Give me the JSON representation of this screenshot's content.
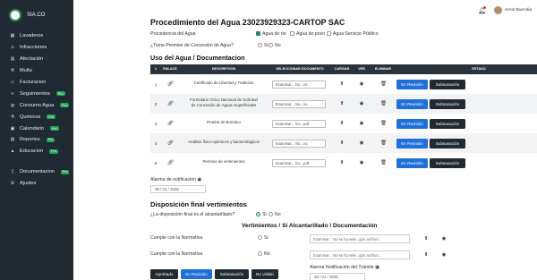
{
  "sidebar": {
    "brand": "SIA.CO",
    "items": [
      {
        "label": "Lavaderos",
        "icon": "grid-icon",
        "badge": ""
      },
      {
        "label": "Infracciones",
        "icon": "warning-icon",
        "badge": ""
      },
      {
        "label": "Afectación",
        "icon": "chart-icon",
        "badge": ""
      },
      {
        "label": "Multa",
        "icon": "gavel-icon",
        "badge": ""
      },
      {
        "label": "Facturacion",
        "icon": "invoice-icon",
        "badge": ""
      },
      {
        "label": "Seguimientos",
        "icon": "list-icon",
        "badge": "Pro"
      },
      {
        "label": "Consumo Agua",
        "icon": "water-icon",
        "badge": "Pro"
      },
      {
        "label": "Quimicos",
        "icon": "flask-icon",
        "badge": "Pro"
      },
      {
        "label": "Calendario",
        "icon": "calendar-icon",
        "badge": "Pro"
      },
      {
        "label": "Reportes",
        "icon": "report-icon",
        "badge": "Pro"
      },
      {
        "label": "Educacion",
        "icon": "education-icon",
        "badge": "Pro"
      }
    ],
    "bottom_items": [
      {
        "label": "Documentacion",
        "icon": "document-icon",
        "badge": "Pro"
      },
      {
        "label": "Ajustes",
        "icon": "gear-icon",
        "badge": ""
      }
    ]
  },
  "topbar": {
    "user": "Arnol Buendia"
  },
  "page": {
    "title": "Procedimiento del Agua 23023929323-CARTOP SAC",
    "source_label": "Procedencia del Agua",
    "source_options": [
      {
        "label": "Agua de rio",
        "checked": true
      },
      {
        "label": "Agua de pozo",
        "checked": false
      },
      {
        "label": "Agua Servicio Público",
        "checked": false
      }
    ],
    "permit_question": "¿Tiene Permiso de Concesión de Agua?",
    "yes": "Si",
    "no": "No",
    "uses_title": "Uso del Agua / Documentacion"
  },
  "table": {
    "headers": [
      "#",
      "ENLACE",
      "DESCRIPCION",
      "SELECCIONAR DOCUMENTO",
      "CARGAR",
      "VER",
      "ELIMINAR",
      "ESTADO"
    ],
    "rows": [
      {
        "num": "1",
        "desc1": "Certificado de Libertad y Tradición",
        "desc2": "",
        "file": "Examinar...  No...vo."
      },
      {
        "num": "2",
        "desc1": "Formulario Único Nacional de Solicitud",
        "desc2": "de Concesión de Aguas Superficiales",
        "file": "Examinar...  No...vo."
      },
      {
        "num": "3",
        "desc1": "Prueba de Bombeo",
        "desc2": "",
        "file": "Examinar...  foc...pdf"
      },
      {
        "num": "4",
        "desc1": "Análisis físico-químicos y bacteriológicos",
        "desc2": "",
        "file": "Examinar...  No...vo."
      },
      {
        "num": "5",
        "desc1": "Permiso de vertimientos",
        "desc2": "",
        "file": "Examinar...  foc...pdf"
      }
    ],
    "status_button": "En Revisión",
    "fix_button": "Subsanación"
  },
  "notification": {
    "label": "Alarma de notificación",
    "date": "30 / 01 / 2025"
  },
  "discharge": {
    "title": "Disposición final vertimientos",
    "question": "¿La disposición final es el alcantarillado?",
    "subtitle": "Vertimientos / Si Alcantarillado / Documentación",
    "complies_label": "Cumple con la Normativa",
    "file_placeholder": "Examinar...    No se ha sele...gún archivo.",
    "buttons": [
      "Aprobado",
      "En Revisión",
      "Subsanación",
      "No Válido"
    ],
    "alarm_label": "Alarma Notificación del Trámite",
    "alarm_date": "30 / 01 / 2025"
  }
}
